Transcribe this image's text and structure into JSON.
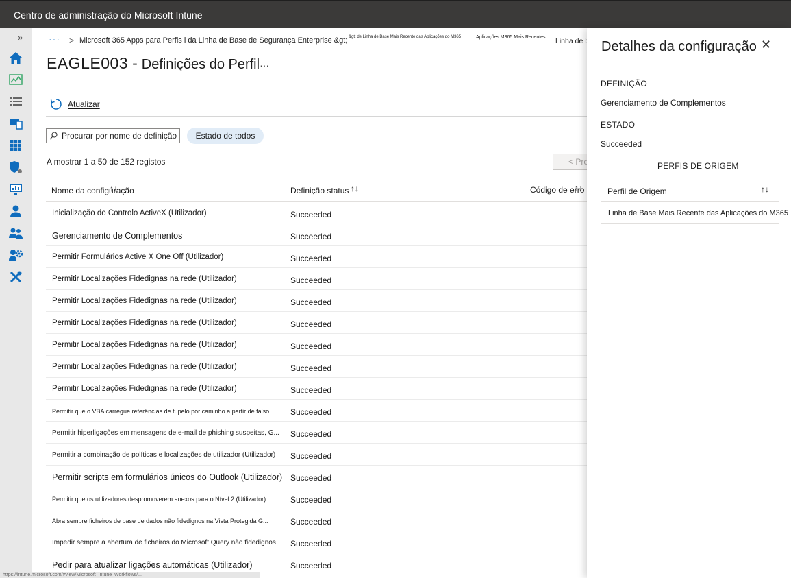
{
  "app": {
    "title": "Centro de administração do Microsoft Intune"
  },
  "nav": {
    "expand_glyph": "»",
    "icons": [
      "home-icon",
      "dashboard-icon",
      "all-services-icon",
      "devices-icon",
      "apps-icon",
      "endpoint-security-icon",
      "reports-icon",
      "users-icon",
      "groups-icon",
      "tenant-admin-icon",
      "troubleshooting-icon"
    ]
  },
  "breadcrumb": {
    "ellipsis": "···",
    "separator": ">",
    "crumb1": "Microsoft 365 Apps para Perfis l da Linha de Base de Segurança Enterprise &gt;",
    "crumb2": "&gt; de Linha de Base Mais Recente das Aplicações do M365",
    "crumb3": "Aplicações M365 Mais Recentes",
    "crumb4": "Linha de base"
  },
  "header": {
    "device": "EAGLE003",
    "dash": "-",
    "page_title": "Definições do Perfil",
    "more": "···"
  },
  "toolbar": {
    "refresh_label": "Atualizar"
  },
  "search": {
    "placeholder": "Procurar por nome de definição"
  },
  "filter": {
    "label": "Estado de todos"
  },
  "paging": {
    "count_text": "A mostrar 1 a 50 de 152 registos",
    "prev_label": "< Pre"
  },
  "table": {
    "columns": [
      "Nome da configuração",
      "Definição status",
      "Código de erro"
    ],
    "sort_glyph": "↑↓",
    "rows": [
      {
        "name": "Inicialização do Controlo ActiveX (Utilizador)",
        "status": "Succeeded"
      },
      {
        "name": "Gerenciamento de Complementos",
        "status": "Succeeded"
      },
      {
        "name": "Permitir Formulários Active X One Off (Utilizador)",
        "status": "Succeeded"
      },
      {
        "name": "Permitir Localizações Fidedignas na rede (Utilizador)",
        "status": "Succeeded"
      },
      {
        "name": "Permitir Localizações Fidedignas na rede (Utilizador)",
        "status": "Succeeded"
      },
      {
        "name": "Permitir Localizações Fidedignas na rede (Utilizador)",
        "status": "Succeeded"
      },
      {
        "name": "Permitir Localizações Fidedignas na rede (Utilizador)",
        "status": "Succeeded"
      },
      {
        "name": "Permitir Localizações Fidedignas na rede (Utilizador)",
        "status": "Succeeded"
      },
      {
        "name": "Permitir Localizações Fidedignas na rede (Utilizador)",
        "status": "Succeeded"
      },
      {
        "name": "Permitir que o VBA carregue referências de tupelo por caminho a partir de falso",
        "status": "Succeeded"
      },
      {
        "name": "Permitir hiperligações em mensagens de e-mail de phishing suspeitas, G...",
        "status": "Succeeded"
      },
      {
        "name": "Permitir a combinação de políticas e localizações de utilizador (Utilizador)",
        "status": "Succeeded"
      },
      {
        "name": "Permitir scripts em formulários únicos do Outlook (Utilizador)",
        "status": "Succeeded"
      },
      {
        "name": "Permitir que os utilizadores despromoverem anexos para o Nível 2 (Utilizador)",
        "status": "Succeeded"
      },
      {
        "name": "Abra sempre ficheiros de base de dados não fidedignos na Vista Protegida G...",
        "status": "Succeeded"
      },
      {
        "name": "Impedir sempre a abertura de ficheiros do Microsoft Query não fidedignos",
        "status": "Succeeded"
      },
      {
        "name": "Pedir para atualizar ligações automáticas (Utilizador)",
        "status": "Succeeded"
      }
    ]
  },
  "statusbar": {
    "text": "https://intune.microsoft.com/#view/Microsoft_Intune_Workflows/..."
  },
  "panel": {
    "title": "Detalhes da configuração",
    "close_glyph": "✕",
    "definition_label": "DEFINIÇÃO",
    "definition_value": "Gerenciamento de Complementos",
    "state_label": "ESTADO",
    "state_value": "Succeeded",
    "source_section": "PERFIS DE ORIGEM",
    "source_column": "Perfil de Origem",
    "source_sort": "↑↓",
    "source_rows": [
      "Linha de Base Mais Recente das Aplicações do M365"
    ]
  },
  "colors": {
    "accent": "#0f6cbd",
    "topbar": "#3b3a39",
    "nav_bg": "#e8e8e8",
    "pill_bg": "#e1ecf7"
  }
}
